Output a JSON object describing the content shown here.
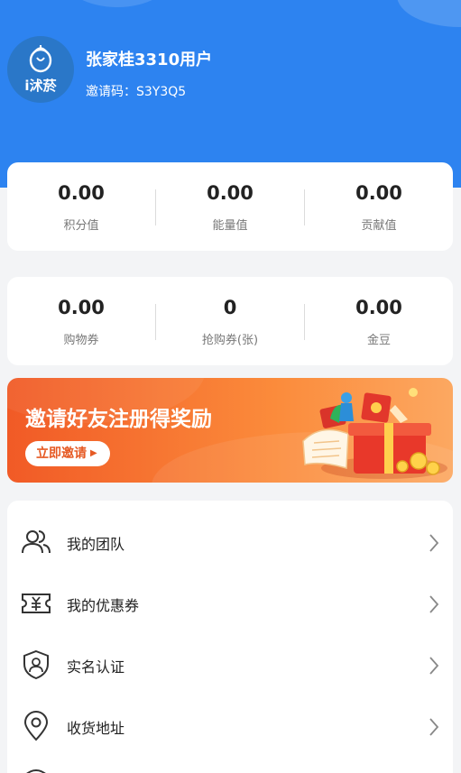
{
  "profile": {
    "username": "张家桂3310用户",
    "invite_code": "邀请码：S3Y3Q5",
    "logo_text": "i沭菸"
  },
  "stats_row1": [
    {
      "value": "0.00",
      "label": "积分值"
    },
    {
      "value": "0.00",
      "label": "能量值"
    },
    {
      "value": "0.00",
      "label": "贡献值"
    }
  ],
  "stats_row2": [
    {
      "value": "0.00",
      "label": "购物券"
    },
    {
      "value": "0",
      "label": "抢购券(张)"
    },
    {
      "value": "0.00",
      "label": "金豆"
    }
  ],
  "banner": {
    "title": "邀请好友注册得奖励",
    "cta": "立即邀请"
  },
  "menu": [
    {
      "label": "我的团队",
      "icon": "team-icon"
    },
    {
      "label": "我的优惠券",
      "icon": "coupon-icon"
    },
    {
      "label": "实名认证",
      "icon": "shield-user-icon"
    },
    {
      "label": "收货地址",
      "icon": "location-pin-icon"
    }
  ],
  "colors": {
    "header_blue": "#2d83f0",
    "banner_orange": "#f15a26",
    "page_bg": "#f3f4f6"
  }
}
